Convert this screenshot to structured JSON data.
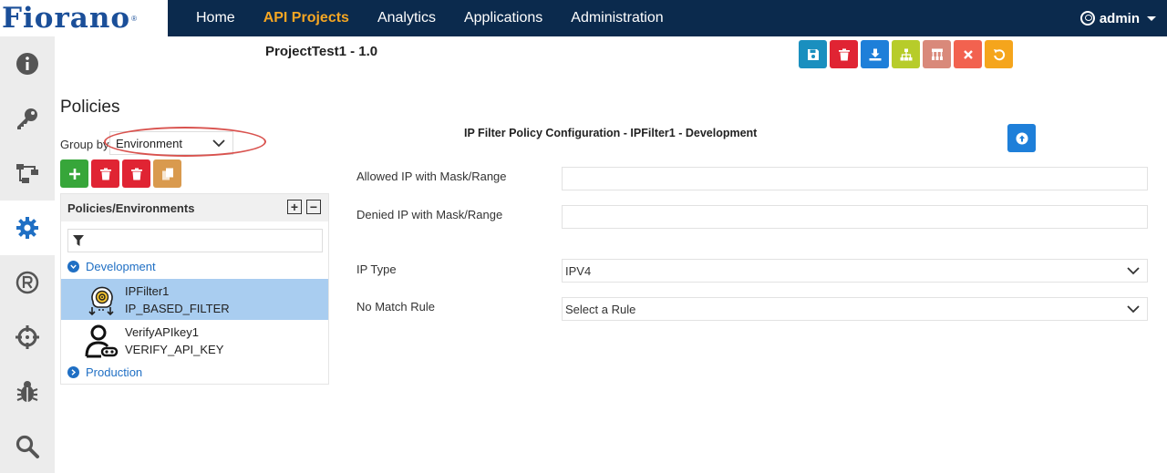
{
  "app": {
    "logo": "Fiorano",
    "logo_mark": "®"
  },
  "nav": {
    "items": [
      {
        "label": "Home"
      },
      {
        "label": "API Projects",
        "active": true
      },
      {
        "label": "Analytics"
      },
      {
        "label": "Applications"
      },
      {
        "label": "Administration"
      }
    ],
    "user": "admin"
  },
  "rail": {
    "icons": [
      "info-icon",
      "key-icon",
      "flow-icon",
      "gear-icon",
      "registered-icon",
      "crosshair-icon",
      "bug-icon",
      "search-icon"
    ],
    "active": "gear-icon"
  },
  "project": {
    "title": "ProjectTest1 - 1.0"
  },
  "toolbar": {
    "buttons": [
      {
        "icon": "save-icon",
        "color": "#1a8fbf"
      },
      {
        "icon": "trash-icon",
        "color": "#e02433"
      },
      {
        "icon": "download-icon",
        "color": "#1e7fd9"
      },
      {
        "icon": "hierarchy-icon",
        "color": "#b7cc2a"
      },
      {
        "icon": "structure-icon",
        "color": "#d9897a"
      },
      {
        "icon": "close-icon",
        "color": "#f2624f"
      },
      {
        "icon": "undo-icon",
        "color": "#f5a51c"
      }
    ]
  },
  "policies": {
    "title": "Policies",
    "group_by_label": "Group by",
    "group_by_value": "Environment",
    "actions": [
      {
        "icon": "plus-icon",
        "color": "#37a63a"
      },
      {
        "icon": "trash-icon",
        "color": "#e02433"
      },
      {
        "icon": "trash-icon",
        "color": "#e02433"
      },
      {
        "icon": "copy-icon",
        "color": "#d99a4e"
      }
    ],
    "tree_header": "Policies/Environments",
    "environments": [
      {
        "name": "Development",
        "expanded": true,
        "items": [
          {
            "name": "IPFilter1",
            "type": "IP_BASED_FILTER",
            "selected": true
          },
          {
            "name": "VerifyAPIkey1",
            "type": "VERIFY_API_KEY",
            "selected": false
          }
        ]
      },
      {
        "name": "Production",
        "expanded": false,
        "items": []
      }
    ]
  },
  "config": {
    "title": "IP Filter Policy Configuration - IPFilter1 - Development",
    "fields": {
      "allowed_ip": {
        "label": "Allowed IP with Mask/Range",
        "value": ""
      },
      "denied_ip": {
        "label": "Denied IP with Mask/Range",
        "value": ""
      },
      "ip_type": {
        "label": "IP Type",
        "value": "IPV4"
      },
      "no_match_rule": {
        "label": "No Match Rule",
        "value": "Select a Rule"
      }
    }
  },
  "colors": {
    "nav_bg": "#0b2a4d",
    "nav_active": "#f5a623",
    "link": "#1f6fc4",
    "selected_row": "#a9cdf0"
  }
}
